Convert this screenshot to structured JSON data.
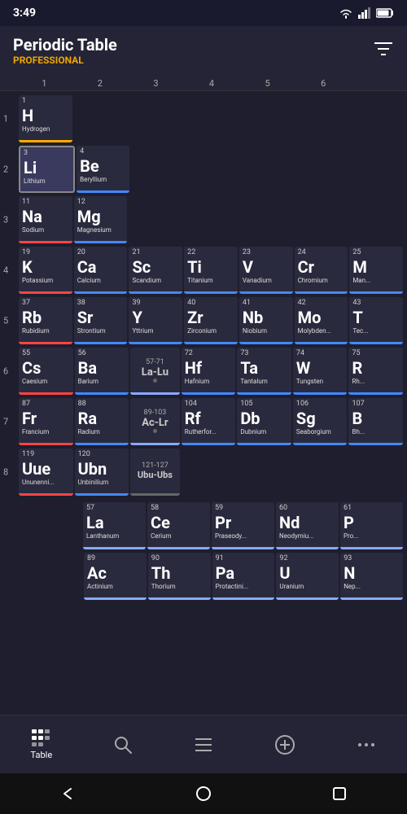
{
  "statusBar": {
    "time": "3:49"
  },
  "header": {
    "title": "Periodic Table",
    "subtitle": "PROFESSIONAL",
    "filterLabel": "filter"
  },
  "columnHeaders": [
    "1",
    "2",
    "3",
    "4",
    "5",
    "6"
  ],
  "periodRows": [
    {
      "period": "1",
      "cells": [
        {
          "number": "1",
          "symbol": "H",
          "name": "Hydrogen",
          "category": "nonmetal",
          "highlighted": false
        },
        {
          "number": "",
          "symbol": "",
          "name": "",
          "category": "empty",
          "highlighted": false
        },
        {
          "number": "",
          "symbol": "",
          "name": "",
          "category": "empty",
          "highlighted": false
        },
        {
          "number": "",
          "symbol": "",
          "name": "",
          "category": "empty",
          "highlighted": false
        },
        {
          "number": "",
          "symbol": "",
          "name": "",
          "category": "empty",
          "highlighted": false
        },
        {
          "number": "",
          "symbol": "",
          "name": "",
          "category": "empty",
          "highlighted": false
        }
      ]
    },
    {
      "period": "2",
      "cells": [
        {
          "number": "3",
          "symbol": "Li",
          "name": "Lithium",
          "category": "alkali-metal",
          "highlighted": true
        },
        {
          "number": "4",
          "symbol": "Be",
          "name": "Beryllium",
          "category": "alkaline-earth",
          "highlighted": false
        },
        {
          "number": "",
          "symbol": "",
          "name": "",
          "category": "empty",
          "highlighted": false
        },
        {
          "number": "",
          "symbol": "",
          "name": "",
          "category": "empty",
          "highlighted": false
        },
        {
          "number": "",
          "symbol": "",
          "name": "",
          "category": "empty",
          "highlighted": false
        },
        {
          "number": "",
          "symbol": "",
          "name": "",
          "category": "empty",
          "highlighted": false
        }
      ]
    },
    {
      "period": "3",
      "cells": [
        {
          "number": "11",
          "symbol": "Na",
          "name": "Sodium",
          "category": "alkali-metal",
          "highlighted": false
        },
        {
          "number": "12",
          "symbol": "Mg",
          "name": "Magnesium",
          "category": "alkaline-earth",
          "highlighted": false
        },
        {
          "number": "",
          "symbol": "",
          "name": "",
          "category": "empty",
          "highlighted": false
        },
        {
          "number": "",
          "symbol": "",
          "name": "",
          "category": "empty",
          "highlighted": false
        },
        {
          "number": "",
          "symbol": "",
          "name": "",
          "category": "empty",
          "highlighted": false
        },
        {
          "number": "",
          "symbol": "",
          "name": "",
          "category": "empty",
          "highlighted": false
        }
      ]
    },
    {
      "period": "4",
      "cells": [
        {
          "number": "19",
          "symbol": "K",
          "name": "Potassium",
          "category": "alkali-metal",
          "highlighted": false
        },
        {
          "number": "20",
          "symbol": "Ca",
          "name": "Calcium",
          "category": "alkaline-earth",
          "highlighted": false
        },
        {
          "number": "21",
          "symbol": "Sc",
          "name": "Scandium",
          "category": "transition",
          "highlighted": false
        },
        {
          "number": "22",
          "symbol": "Ti",
          "name": "Titanium",
          "category": "transition",
          "highlighted": false
        },
        {
          "number": "23",
          "symbol": "V",
          "name": "Vanadium",
          "category": "transition",
          "highlighted": false
        },
        {
          "number": "24",
          "symbol": "Cr",
          "name": "Chromium",
          "category": "transition",
          "highlighted": false
        }
      ]
    },
    {
      "period": "5",
      "cells": [
        {
          "number": "37",
          "symbol": "Rb",
          "name": "Rubidium",
          "category": "alkali-metal",
          "highlighted": false
        },
        {
          "number": "38",
          "symbol": "Sr",
          "name": "Strontium",
          "category": "alkaline-earth",
          "highlighted": false
        },
        {
          "number": "39",
          "symbol": "Y",
          "name": "Yttrium",
          "category": "transition",
          "highlighted": false
        },
        {
          "number": "40",
          "symbol": "Zr",
          "name": "Zirconium",
          "category": "transition",
          "highlighted": false
        },
        {
          "number": "41",
          "symbol": "Nb",
          "name": "Niobium",
          "category": "transition",
          "highlighted": false
        },
        {
          "number": "42",
          "symbol": "Mo",
          "name": "Molybden...",
          "category": "transition",
          "highlighted": false
        }
      ]
    },
    {
      "period": "6",
      "cells": [
        {
          "number": "55",
          "symbol": "Cs",
          "name": "Caesium",
          "category": "alkali-metal",
          "highlighted": false
        },
        {
          "number": "56",
          "symbol": "Ba",
          "name": "Barium",
          "category": "alkaline-earth",
          "highlighted": false
        },
        {
          "number": "57-71",
          "symbol": "La-Lu",
          "name": "",
          "category": "range",
          "highlighted": false
        },
        {
          "number": "72",
          "symbol": "Hf",
          "name": "Hafnium",
          "category": "transition",
          "highlighted": false
        },
        {
          "number": "73",
          "symbol": "Ta",
          "name": "Tantalum",
          "category": "transition",
          "highlighted": false
        },
        {
          "number": "74",
          "symbol": "W",
          "name": "Tungsten",
          "category": "transition",
          "highlighted": false
        }
      ]
    },
    {
      "period": "7",
      "cells": [
        {
          "number": "87",
          "symbol": "Fr",
          "name": "Francium",
          "category": "alkali-metal",
          "highlighted": false
        },
        {
          "number": "88",
          "symbol": "Ra",
          "name": "Radium",
          "category": "alkaline-earth",
          "highlighted": false
        },
        {
          "number": "89-103",
          "symbol": "Ac-Lr",
          "name": "",
          "category": "range",
          "highlighted": false
        },
        {
          "number": "104",
          "symbol": "Rf",
          "name": "Rutherfor...",
          "category": "transition",
          "highlighted": false
        },
        {
          "number": "105",
          "symbol": "Db",
          "name": "Dubnium",
          "category": "transition",
          "highlighted": false
        },
        {
          "number": "106",
          "symbol": "Sg",
          "name": "Seaborgium",
          "category": "transition",
          "highlighted": false
        }
      ]
    },
    {
      "period": "8",
      "cells": [
        {
          "number": "119",
          "symbol": "Uue",
          "name": "Ununenni...",
          "category": "alkali-metal",
          "highlighted": false
        },
        {
          "number": "120",
          "symbol": "Ubn",
          "name": "Unbinilium",
          "category": "alkaline-earth",
          "highlighted": false
        },
        {
          "number": "121-127",
          "symbol": "Ubu-Ubs",
          "name": "",
          "category": "range",
          "highlighted": false
        },
        {
          "number": "",
          "symbol": "",
          "name": "",
          "category": "empty",
          "highlighted": false
        },
        {
          "number": "",
          "symbol": "",
          "name": "",
          "category": "empty",
          "highlighted": false
        },
        {
          "number": "",
          "symbol": "",
          "name": "",
          "category": "empty",
          "highlighted": false
        }
      ]
    }
  ],
  "lanthanideRow": {
    "cells": [
      {
        "number": "57",
        "symbol": "La",
        "name": "Lanthanum",
        "category": "lanthanide"
      },
      {
        "number": "58",
        "symbol": "Ce",
        "name": "Cerium",
        "category": "lanthanide"
      },
      {
        "number": "59",
        "symbol": "Pr",
        "name": "Praseody...",
        "category": "lanthanide"
      },
      {
        "number": "60",
        "symbol": "Nd",
        "name": "Neodymiu...",
        "category": "lanthanide"
      }
    ]
  },
  "actinideRow": {
    "cells": [
      {
        "number": "89",
        "symbol": "Ac",
        "name": "Actinium",
        "category": "actinide"
      },
      {
        "number": "90",
        "symbol": "Th",
        "name": "Thorium",
        "category": "actinide"
      },
      {
        "number": "91",
        "symbol": "Pa",
        "name": "Protactini...",
        "category": "actinide"
      },
      {
        "number": "92",
        "symbol": "U",
        "name": "Uranium",
        "category": "actinide"
      }
    ]
  },
  "bottomNav": {
    "items": [
      {
        "label": "Table",
        "icon": "⊞",
        "active": true
      },
      {
        "label": "",
        "icon": "🔍",
        "active": false
      },
      {
        "label": "",
        "icon": "☰",
        "active": false
      },
      {
        "label": "",
        "icon": "⊕",
        "active": false
      },
      {
        "label": "",
        "icon": "···",
        "active": false
      }
    ]
  },
  "extraCells": {
    "period4_extra": {
      "number": "25",
      "symbol": "Mn",
      "name": "Mangan...",
      "category": "transition"
    },
    "period5_extra": {
      "number": "43",
      "symbol": "Tc",
      "name": "Technet...",
      "category": "transition"
    },
    "period6_extra": {
      "number": "75",
      "symbol": "Rh",
      "name": "Rh",
      "category": "transition"
    },
    "period7_extra": {
      "number": "107",
      "symbol": "Bh",
      "name": "Bh",
      "category": "transition"
    }
  }
}
